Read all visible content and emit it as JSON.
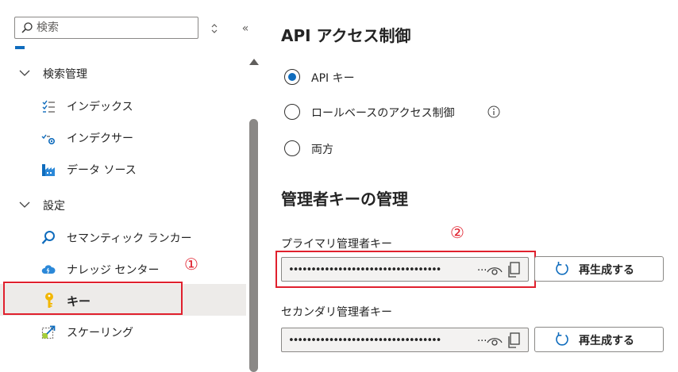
{
  "sidebar": {
    "search": {
      "placeholder": "検索",
      "value": ""
    },
    "groups": [
      {
        "label": "検索管理",
        "items": [
          {
            "label": "インデックス",
            "icon": "index-list-icon"
          },
          {
            "label": "インデクサー",
            "icon": "indexer-icon"
          },
          {
            "label": "データ ソース",
            "icon": "data-source-icon"
          }
        ]
      },
      {
        "label": "設定",
        "items": [
          {
            "label": "セマンティック ランカー",
            "icon": "semantic-search-icon"
          },
          {
            "label": "ナレッジ センター",
            "icon": "knowledge-cloud-icon"
          },
          {
            "label": "キー",
            "icon": "key-icon",
            "selected": true
          },
          {
            "label": "スケーリング",
            "icon": "scale-icon"
          }
        ]
      }
    ],
    "markers": {
      "keys_step": "①"
    }
  },
  "main": {
    "api_access": {
      "title": "API アクセス制御",
      "options": [
        {
          "label": "API キー",
          "selected": true
        },
        {
          "label": "ロールベースのアクセス制御",
          "selected": false
        },
        {
          "label": "両方",
          "selected": false
        }
      ]
    },
    "admin_keys": {
      "title": "管理者キーの管理",
      "primary": {
        "label": "プライマリ管理者キー",
        "value": "••••••••••••••••••••••••••••••••••",
        "regenerate_label": "再生成する"
      },
      "secondary": {
        "label": "セカンダリ管理者キー",
        "value": "••••••••••••••••••••••••••••••••••",
        "regenerate_label": "再生成する"
      },
      "step_marker": "②"
    }
  },
  "colors": {
    "accent": "#0f6cbd",
    "highlight_box": "#e0202d",
    "selected_row": "#edebe9",
    "key_icon": "#f2b705"
  }
}
